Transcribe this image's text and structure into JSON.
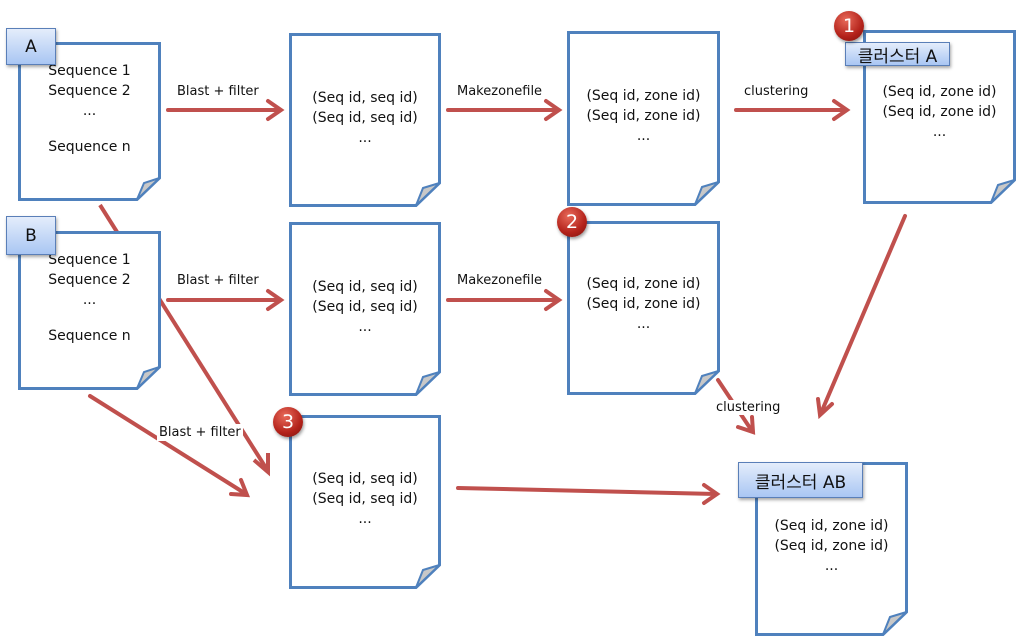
{
  "colors": {
    "doc_border": "#4f81bd",
    "arrow": "#c0504d",
    "badge": "#c0392b"
  },
  "sources": [
    {
      "label": "A",
      "lines": [
        "Sequence 1",
        "Sequence 2",
        "...",
        "",
        "Sequence n"
      ]
    },
    {
      "label": "B",
      "lines": [
        "Sequence 1",
        "Sequence 2",
        "...",
        "",
        "Sequence n"
      ]
    }
  ],
  "pairs": {
    "line1": "(Seq id, seq id)",
    "line2": "(Seq id, seq id)",
    "ellipsis": "..."
  },
  "zones": {
    "line1": "(Seq id, zone id)",
    "line2": "(Seq id, zone id)",
    "ellipsis": "..."
  },
  "clusters": [
    {
      "label": "클러스터 A"
    },
    {
      "label": "클러스터 AB"
    }
  ],
  "badges": [
    "1",
    "2",
    "3"
  ],
  "arrow_labels": {
    "blast": "Blast + filter",
    "makezone": "Makezonefile",
    "clustering": "clustering"
  }
}
